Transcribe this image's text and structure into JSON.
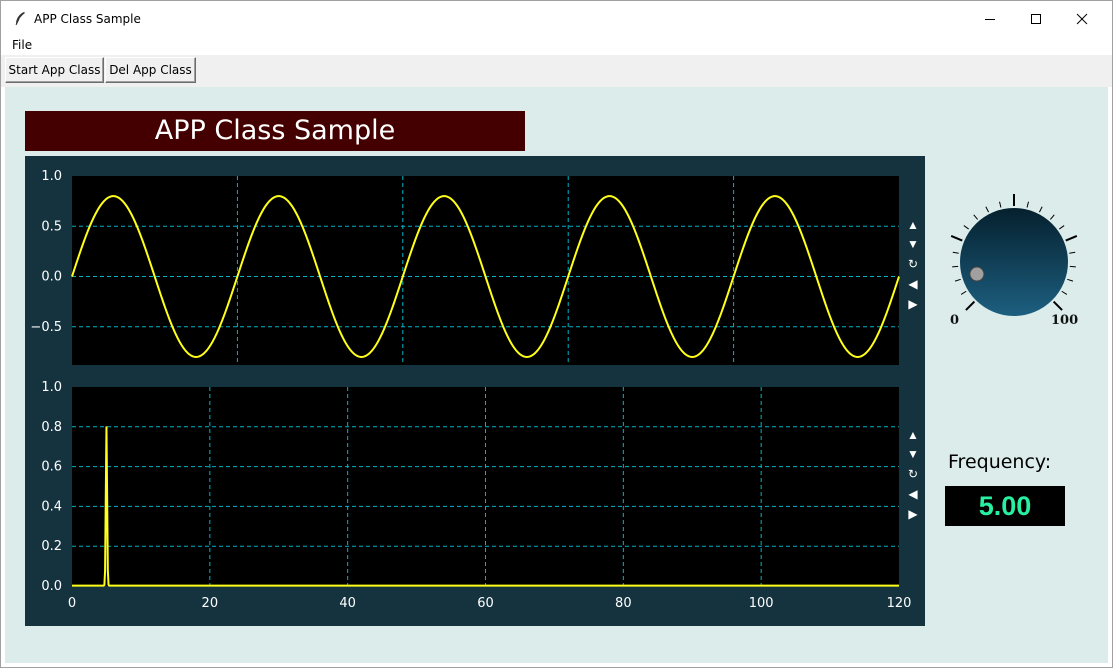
{
  "window": {
    "title": "APP Class Sample",
    "icon": "feather-icon",
    "controls": [
      "minimize-icon",
      "maximize-icon",
      "close-icon"
    ]
  },
  "menu": {
    "file": "File"
  },
  "toolbar": {
    "start_label": "Start App Class",
    "del_label": "Del App Class"
  },
  "banner": {
    "title": "APP Class Sample"
  },
  "plot_nav": {
    "up": "▲",
    "down": "▼",
    "reset": "↻",
    "left": "◀",
    "right": "▶"
  },
  "knob": {
    "min_label": "0",
    "max_label": "100",
    "value_fraction": 0.1,
    "colors": {
      "top": "#05202e",
      "bottom": "#1d5f80",
      "marker": "#a0a0a0"
    }
  },
  "frequency": {
    "label": "Frequency:",
    "value": "5.00"
  },
  "colors": {
    "plot_bg": "#000000",
    "panel_bg": "#15333f",
    "line": "#ffff19",
    "grid": "#00b4c8",
    "banner_bg": "#440000",
    "client_bg": "#dbeceb",
    "freq_text": "#27f0a0"
  },
  "chart_data": [
    {
      "type": "line",
      "title": "",
      "xlabel": "",
      "ylabel": "",
      "x_range": [
        0,
        5
      ],
      "ylim": [
        -0.88,
        1.0
      ],
      "yticks": [
        "1.0",
        "0.5",
        "0.0",
        "−0.5"
      ],
      "ytick_values": [
        1.0,
        0.5,
        0.0,
        -0.5
      ],
      "grid": true,
      "series": [
        {
          "function": "sine",
          "amplitude": 0.8,
          "cycles": 5,
          "color": "#ffff19"
        }
      ]
    },
    {
      "type": "line",
      "title": "",
      "xlabel": "",
      "ylabel": "",
      "xlim": [
        0,
        120
      ],
      "ylim": [
        0.0,
        1.0
      ],
      "xticks": [
        "0",
        "20",
        "40",
        "60",
        "80",
        "100",
        "120"
      ],
      "xtick_values": [
        0,
        20,
        40,
        60,
        80,
        100,
        120
      ],
      "yticks": [
        "1.0",
        "0.8",
        "0.6",
        "0.4",
        "0.2",
        "0.0"
      ],
      "ytick_values": [
        1.0,
        0.8,
        0.6,
        0.4,
        0.2,
        0.0
      ],
      "grid": true,
      "series": [
        {
          "function": "spectrum-peak",
          "peak_x": 5,
          "peak_y": 0.8,
          "color": "#ffff19"
        }
      ]
    }
  ]
}
